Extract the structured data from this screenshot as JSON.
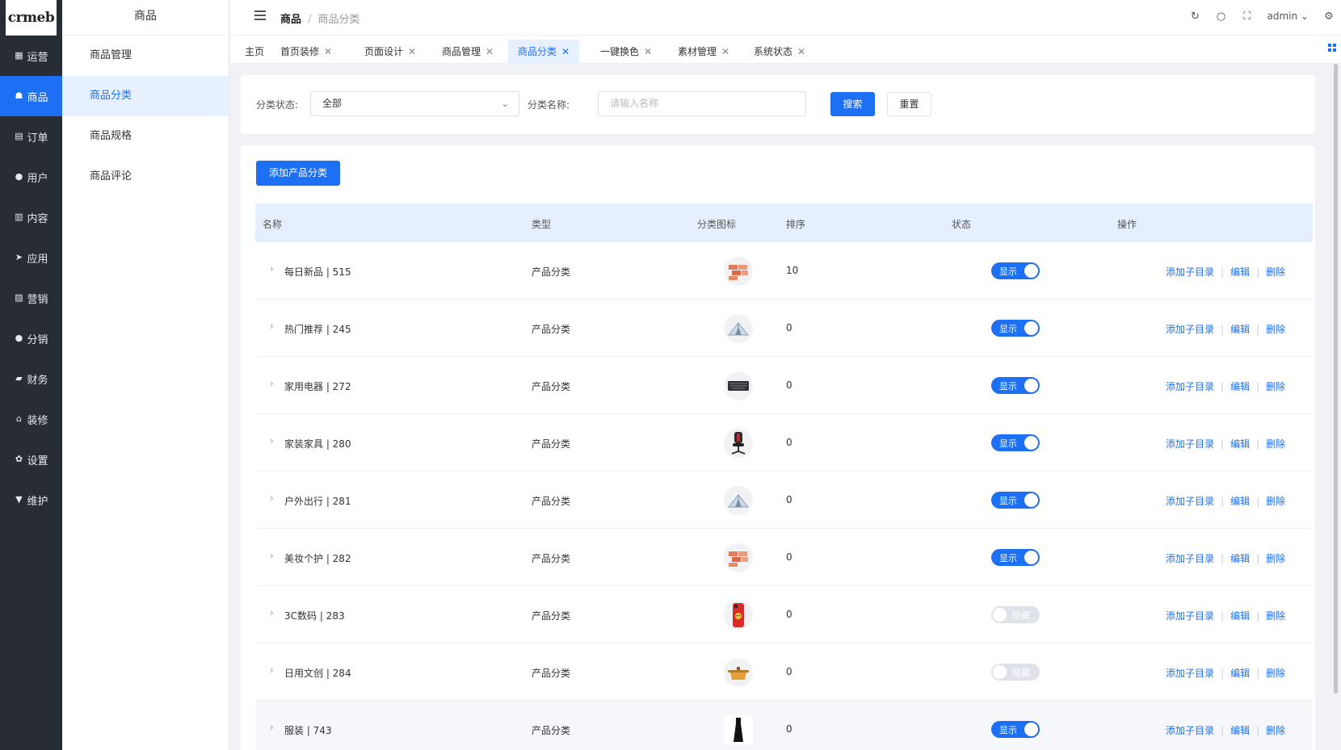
{
  "logo": "crmeb",
  "sidebar": {
    "items": [
      {
        "label": "运营",
        "icon": "grid-icon",
        "glyph": "▦"
      },
      {
        "label": "商品",
        "icon": "bag-icon",
        "glyph": "☗"
      },
      {
        "label": "订单",
        "icon": "clipboard-icon",
        "glyph": "▤"
      },
      {
        "label": "用户",
        "icon": "user-icon",
        "glyph": "●"
      },
      {
        "label": "内容",
        "icon": "book-icon",
        "glyph": "▥"
      },
      {
        "label": "应用",
        "icon": "send-icon",
        "glyph": "➤"
      },
      {
        "label": "营销",
        "icon": "chart-icon",
        "glyph": "▨"
      },
      {
        "label": "分销",
        "icon": "person-icon",
        "glyph": "●"
      },
      {
        "label": "财务",
        "icon": "wallet-icon",
        "glyph": "▰"
      },
      {
        "label": "装修",
        "icon": "home-icon",
        "glyph": "⌂"
      },
      {
        "label": "设置",
        "icon": "gear-icon",
        "glyph": "✿"
      },
      {
        "label": "维护",
        "icon": "tool-icon",
        "glyph": "▼"
      }
    ]
  },
  "submenu": {
    "title": "商品",
    "items": [
      "商品管理",
      "商品分类",
      "商品规格",
      "商品评论"
    ]
  },
  "header": {
    "crumb1": "商品",
    "crumb2": "商品分类",
    "user": "admin"
  },
  "tabs": [
    "主页",
    "首页装修",
    "页面设计",
    "商品管理",
    "商品分类",
    "一键换色",
    "素材管理",
    "系统状态"
  ],
  "filter": {
    "status_label": "分类状态:",
    "status_value": "全部",
    "name_label": "分类名称:",
    "name_placeholder": "请输入名称",
    "search_btn": "搜索",
    "reset_btn": "重置"
  },
  "add_btn": "添加产品分类",
  "table": {
    "headers": [
      "名称",
      "类型",
      "分类图标",
      "排序",
      "状态",
      "操作"
    ],
    "rows": [
      {
        "name": "每日新品 | 515",
        "type": "产品分类",
        "icon": "bricks",
        "sort": "10",
        "status": "显示",
        "on": true
      },
      {
        "name": "热门推荐 | 245",
        "type": "产品分类",
        "icon": "tent",
        "sort": "0",
        "status": "显示",
        "on": true
      },
      {
        "name": "家用电器 | 272",
        "type": "产品分类",
        "icon": "keyboard",
        "sort": "0",
        "status": "显示",
        "on": true
      },
      {
        "name": "家装家具 | 280",
        "type": "产品分类",
        "icon": "chair",
        "sort": "0",
        "status": "显示",
        "on": true
      },
      {
        "name": "户外出行 | 281",
        "type": "产品分类",
        "icon": "tent",
        "sort": "0",
        "status": "显示",
        "on": true
      },
      {
        "name": "美妆个护 | 282",
        "type": "产品分类",
        "icon": "bricks",
        "sort": "0",
        "status": "显示",
        "on": true
      },
      {
        "name": "3C数码 | 283",
        "type": "产品分类",
        "icon": "phone",
        "sort": "0",
        "status": "隐藏",
        "on": false
      },
      {
        "name": "日用文创 | 284",
        "type": "产品分类",
        "icon": "pot",
        "sort": "0",
        "status": "隐藏",
        "on": false
      },
      {
        "name": "服装 | 743",
        "type": "产品分类",
        "icon": "dress",
        "sort": "0",
        "status": "显示",
        "on": true
      }
    ],
    "ops": [
      "添加子目录",
      "编辑",
      "删除"
    ]
  },
  "colors": {
    "accent": "#1d6ff3",
    "sidebar": "#282c35"
  }
}
